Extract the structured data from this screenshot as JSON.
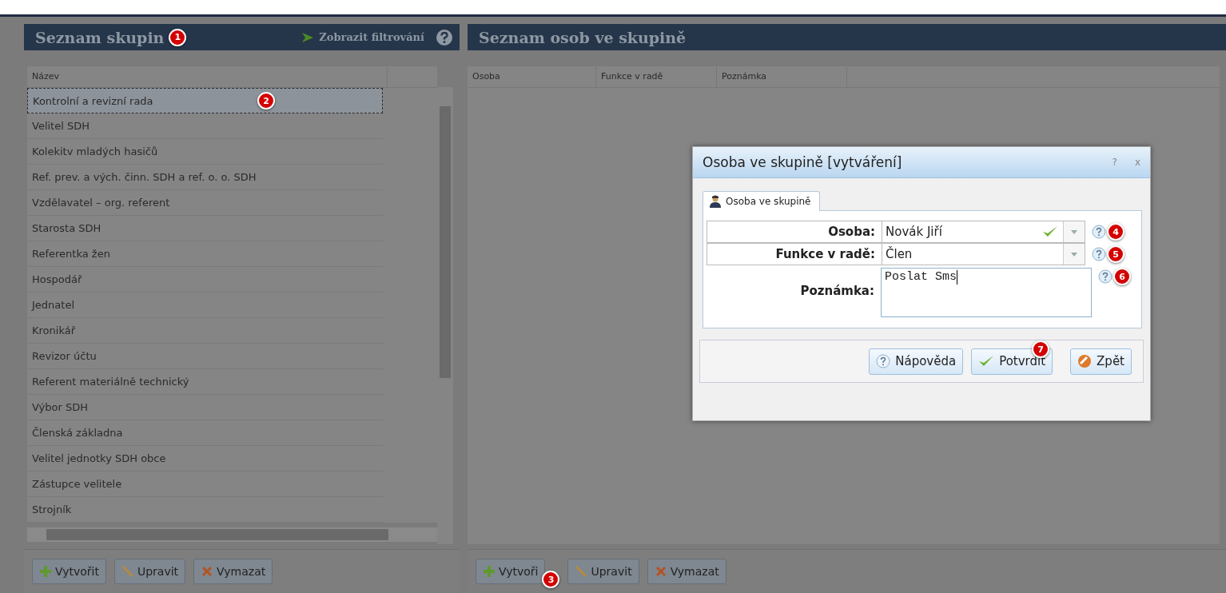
{
  "left_panel": {
    "title": "Seznam skupin",
    "title_badge": "1",
    "filter_link": "Zobrazit filtrování",
    "columns": [
      "Název"
    ],
    "rows": [
      {
        "name": "Kontrolní a revizní rada",
        "selected": true,
        "badge": "2"
      },
      {
        "name": "Velitel SDH",
        "selected": false
      },
      {
        "name": "Kolekitv mladých hasičů",
        "selected": false
      },
      {
        "name": "Ref. prev. a vých. činn. SDH a ref. o. o. SDH",
        "selected": false
      },
      {
        "name": "Vzdělavatel – org. referent",
        "selected": false
      },
      {
        "name": "Starosta SDH",
        "selected": false
      },
      {
        "name": "Referentka žen",
        "selected": false
      },
      {
        "name": "Hospodář",
        "selected": false
      },
      {
        "name": "Jednatel",
        "selected": false
      },
      {
        "name": "Kronikář",
        "selected": false
      },
      {
        "name": "Revizor účtu",
        "selected": false
      },
      {
        "name": "Referent materiálně technický",
        "selected": false
      },
      {
        "name": "Výbor SDH",
        "selected": false
      },
      {
        "name": "Členská základna",
        "selected": false
      },
      {
        "name": "Velitel jednotky SDH obce",
        "selected": false
      },
      {
        "name": "Zástupce velitele",
        "selected": false
      },
      {
        "name": "Strojník",
        "selected": false
      }
    ],
    "buttons": [
      {
        "label": "Vytvořit",
        "kind": "add"
      },
      {
        "label": "Upravit",
        "kind": "edit"
      },
      {
        "label": "Vymazat",
        "kind": "delete"
      }
    ]
  },
  "right_panel": {
    "title": "Seznam osob ve skupině",
    "columns": [
      "Osoba",
      "Funkce v radě",
      "Poznámka"
    ],
    "buttons": [
      {
        "label": "Vytvoři",
        "kind": "add",
        "badge": "3"
      },
      {
        "label": "Upravit",
        "kind": "edit"
      },
      {
        "label": "Vymazat",
        "kind": "delete"
      }
    ]
  },
  "dialog": {
    "title": "Osoba ve skupině [vytváření]",
    "title_buttons": [
      "?",
      "x"
    ],
    "tab": "Osoba ve skupině",
    "fields": [
      {
        "label": "Osoba:",
        "value": "Novák Jiří",
        "kind": "combo",
        "valid": true,
        "badge": "4"
      },
      {
        "label": "Funkce v radě:",
        "value": "Člen",
        "kind": "combo",
        "valid": false,
        "badge": "5"
      },
      {
        "label": "Poznámka:",
        "value": "Poslat Sms",
        "kind": "textarea",
        "badge": "6"
      }
    ],
    "buttons": [
      {
        "label": "Nápověda",
        "kind": "help"
      },
      {
        "label": "Potvrdit",
        "kind": "confirm",
        "badge": "7"
      },
      {
        "label": "Zpět",
        "kind": "back"
      }
    ]
  }
}
